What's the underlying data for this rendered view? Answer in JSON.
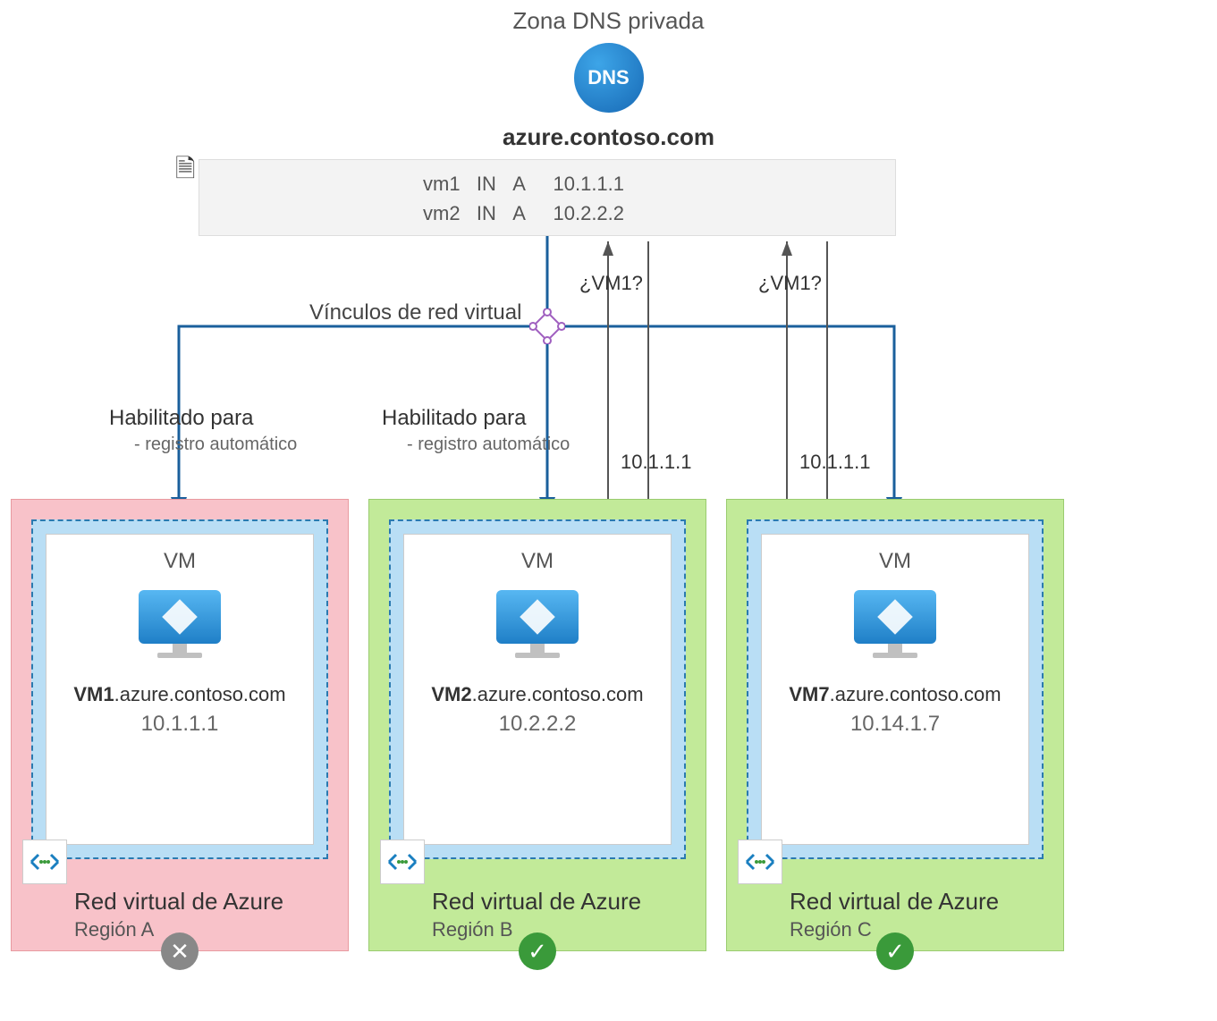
{
  "title": "Zona DNS privada",
  "dns_icon_label": "DNS",
  "domain": "azure.contoso.com",
  "records": [
    {
      "name": "vm1",
      "class": "IN",
      "type": "A",
      "ip": "10.1.1.1"
    },
    {
      "name": "vm2",
      "class": "IN",
      "type": "A",
      "ip": "10.2.2.2"
    }
  ],
  "vnet_links_label": "Vínculos de red virtual",
  "enabled": {
    "title": "Habilitado para",
    "subtitle": "- registro automático"
  },
  "queries": {
    "q_b": "¿VM1?",
    "q_c": "¿VM1?"
  },
  "answers": {
    "a_b": "10.1.1.1",
    "a_c": "10.1.1.1"
  },
  "regions": [
    {
      "key": "a",
      "vm_label": "VM",
      "vm_name": "VM1",
      "fqdn_suffix": ".azure.contoso.com",
      "ip": "10.1.1.1",
      "vnet_label": "Red virtual de Azure",
      "region_label": "Región A",
      "status": "fail"
    },
    {
      "key": "b",
      "vm_label": "VM",
      "vm_name": "VM2",
      "fqdn_suffix": ".azure.contoso.com",
      "ip": "10.2.2.2",
      "vnet_label": "Red virtual de Azure",
      "region_label": "Región B",
      "status": "ok"
    },
    {
      "key": "c",
      "vm_label": "VM",
      "vm_name": "VM7",
      "fqdn_suffix": ".azure.contoso.com",
      "ip": "10.14.1.7",
      "vnet_label": "Red virtual de Azure",
      "region_label": "Región C",
      "status": "ok"
    }
  ]
}
